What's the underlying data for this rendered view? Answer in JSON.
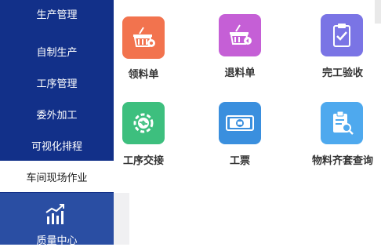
{
  "sidebar": {
    "items": [
      {
        "label": "生产管理"
      },
      {
        "label": "自制生产"
      },
      {
        "label": "工序管理"
      },
      {
        "label": "委外加工"
      },
      {
        "label": "可视化排程"
      },
      {
        "label": "车间现场作业"
      }
    ],
    "quality": {
      "label": "质量中心",
      "icon": "bar-chart-trend-icon"
    }
  },
  "apps": [
    {
      "label": "领料单",
      "icon": "basket-gear-icon",
      "color": "#F2734E"
    },
    {
      "label": "退料单",
      "icon": "basket-return-icon",
      "color": "#C55FD6"
    },
    {
      "label": "完工验收",
      "icon": "clipboard-check-icon",
      "color": "#7A74E5"
    },
    {
      "label": "工序交接",
      "icon": "gear-exchange-icon",
      "color": "#3DBF7E"
    },
    {
      "label": "工票",
      "icon": "ticket-icon",
      "color": "#3A8FDE"
    },
    {
      "label": "物料齐套查询",
      "icon": "clipboard-search-icon",
      "color": "#4EA9EE"
    }
  ]
}
